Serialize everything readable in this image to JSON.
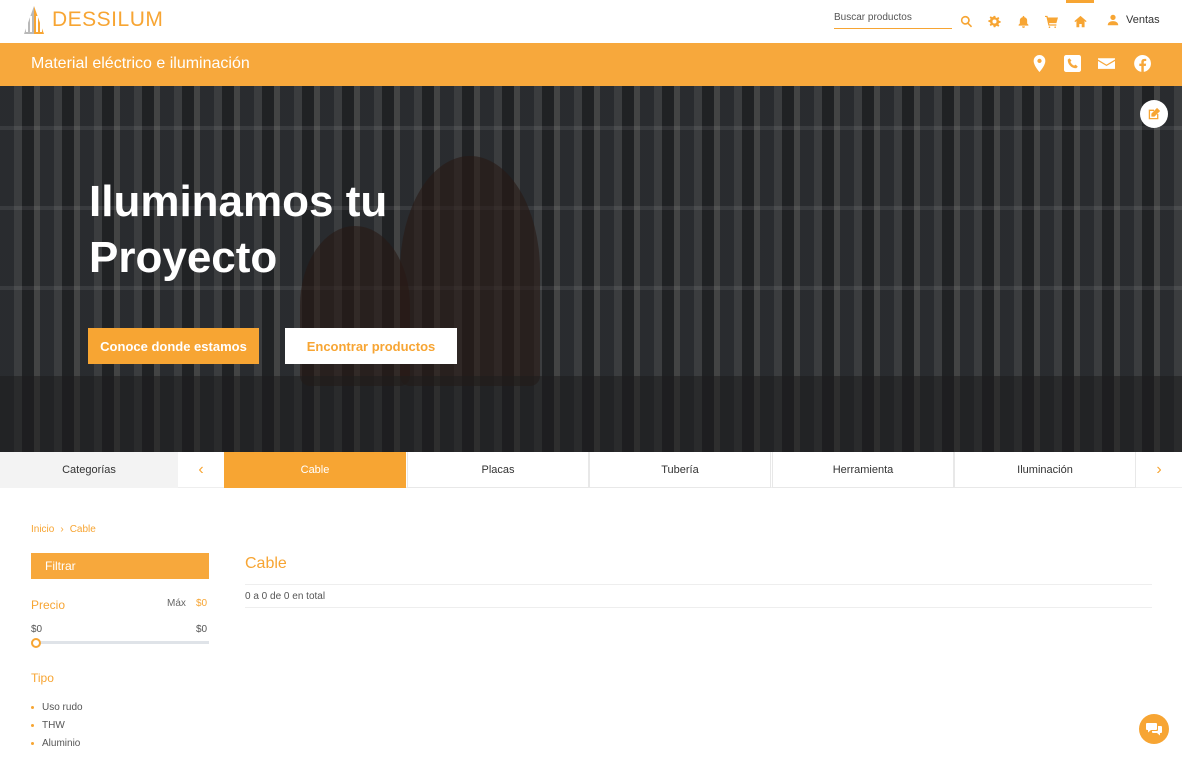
{
  "brand": {
    "name": "DESSILUM",
    "accent": "#f7a533"
  },
  "header": {
    "search_placeholder": "Buscar productos",
    "user_label": "Ventas",
    "icons": [
      "search-icon",
      "gear-icon",
      "bell-icon",
      "cart-icon",
      "home-icon",
      "user-icon"
    ]
  },
  "banner": {
    "tagline": "Material eléctrico e iluminación",
    "icons": [
      "map-pin-icon",
      "phone-icon",
      "envelope-icon",
      "facebook-icon"
    ]
  },
  "hero": {
    "title": "Iluminamos tu Proyecto",
    "primary_button": "Conoce donde estamos",
    "secondary_button": "Encontrar productos"
  },
  "categories": {
    "label": "Categorías",
    "tabs": [
      {
        "label": "Cable",
        "active": true
      },
      {
        "label": "Placas",
        "active": false
      },
      {
        "label": "Tubería",
        "active": false
      },
      {
        "label": "Herramienta",
        "active": false
      },
      {
        "label": "Iluminación",
        "active": false
      }
    ]
  },
  "breadcrumb": {
    "home": "Inicio",
    "separator": "›",
    "current": "Cable"
  },
  "filter": {
    "title": "Filtrar",
    "price_label": "Precio",
    "max_label": "Máx",
    "max_value": "$0",
    "range_min": "$0",
    "range_max": "$0",
    "type_label": "Tipo",
    "types": [
      "Uso rudo",
      "THW",
      "Aluminio"
    ]
  },
  "results": {
    "title": "Cable",
    "count_text": "0 a 0 de 0 en total"
  }
}
